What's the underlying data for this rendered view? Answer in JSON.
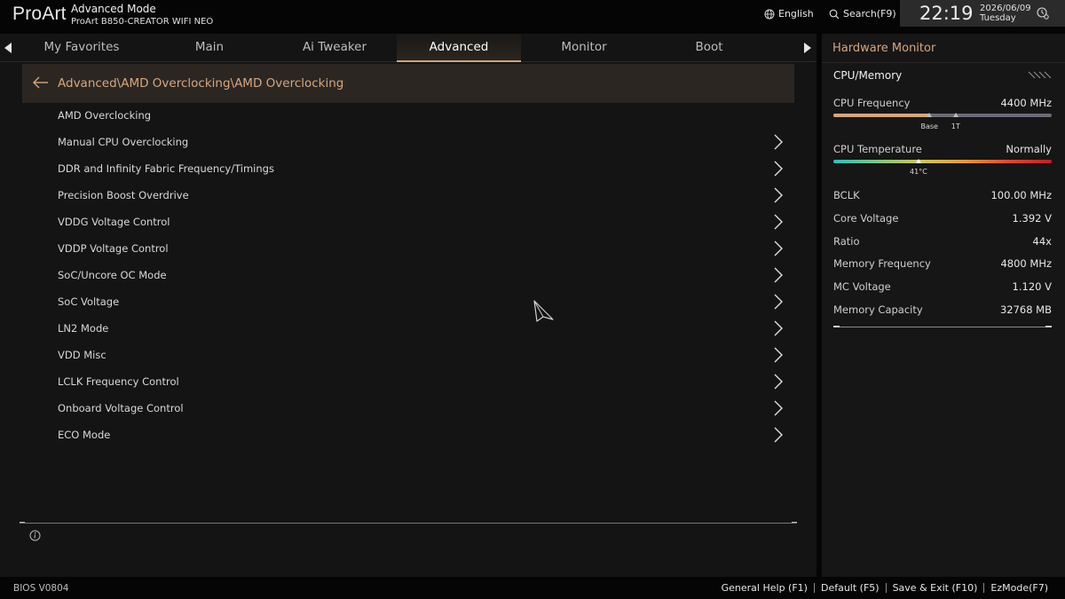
{
  "header": {
    "logo": "ProArt",
    "mode_title": "Advanced Mode",
    "board_name": "ProArt B850-CREATOR WIFI NEO",
    "language_label": "English",
    "language_icon": "globe-icon",
    "search_label": "Search(F9)",
    "search_icon": "search-icon",
    "time": "22:19",
    "date": "2026/06/09",
    "day": "Tuesday",
    "clock_settings_icon": "clock-gear-icon"
  },
  "tabs": [
    {
      "label": "My Favorites"
    },
    {
      "label": "Main"
    },
    {
      "label": "Ai Tweaker"
    },
    {
      "label": "Advanced",
      "active": true
    },
    {
      "label": "Monitor"
    },
    {
      "label": "Boot"
    }
  ],
  "main": {
    "breadcrumb": "Advanced\\AMD Overclocking\\AMD Overclocking",
    "section_title": "AMD Overclocking",
    "items": [
      {
        "label": "Manual CPU Overclocking"
      },
      {
        "label": "DDR and Infinity Fabric Frequency/Timings"
      },
      {
        "label": "Precision Boost Overdrive"
      },
      {
        "label": "VDDG Voltage Control"
      },
      {
        "label": "VDDP Voltage Control"
      },
      {
        "label": "SoC/Uncore OC Mode"
      },
      {
        "label": "SoC Voltage"
      },
      {
        "label": "LN2 Mode"
      },
      {
        "label": "VDD Misc"
      },
      {
        "label": "LCLK Frequency Control"
      },
      {
        "label": "Onboard Voltage Control"
      },
      {
        "label": "ECO Mode"
      }
    ]
  },
  "hw_monitor": {
    "title": "Hardware Monitor",
    "section": "CPU/Memory",
    "cpu_frequency": {
      "label": "CPU Frequency",
      "value": "4400 MHz",
      "fill_fraction": 0.44,
      "base_label": "Base",
      "onet_label": "1T",
      "base_fraction": 0.44,
      "onet_fraction": 0.56
    },
    "cpu_temperature": {
      "label": "CPU Temperature",
      "value": "Normally",
      "reading": "41°C",
      "marker_fraction": 0.39
    },
    "rows": [
      {
        "label": "BCLK",
        "value": "100.00 MHz"
      },
      {
        "label": "Core Voltage",
        "value": "1.392 V"
      },
      {
        "label": "Ratio",
        "value": "44x"
      },
      {
        "label": "Memory Frequency",
        "value": "4800 MHz"
      },
      {
        "label": "MC Voltage",
        "value": "1.120 V"
      },
      {
        "label": "Memory Capacity",
        "value": "32768 MB"
      }
    ]
  },
  "footer": {
    "bios_version": "BIOS V0804",
    "shortcuts": [
      {
        "label": "General Help (F1)"
      },
      {
        "label": "Default (F5)"
      },
      {
        "label": "Save & Exit (F10)"
      },
      {
        "label": "EzMode(F7)"
      }
    ]
  },
  "colors": {
    "accent": "#d7a77e",
    "background": "#141414",
    "bar_fill": "#d9a67c"
  }
}
